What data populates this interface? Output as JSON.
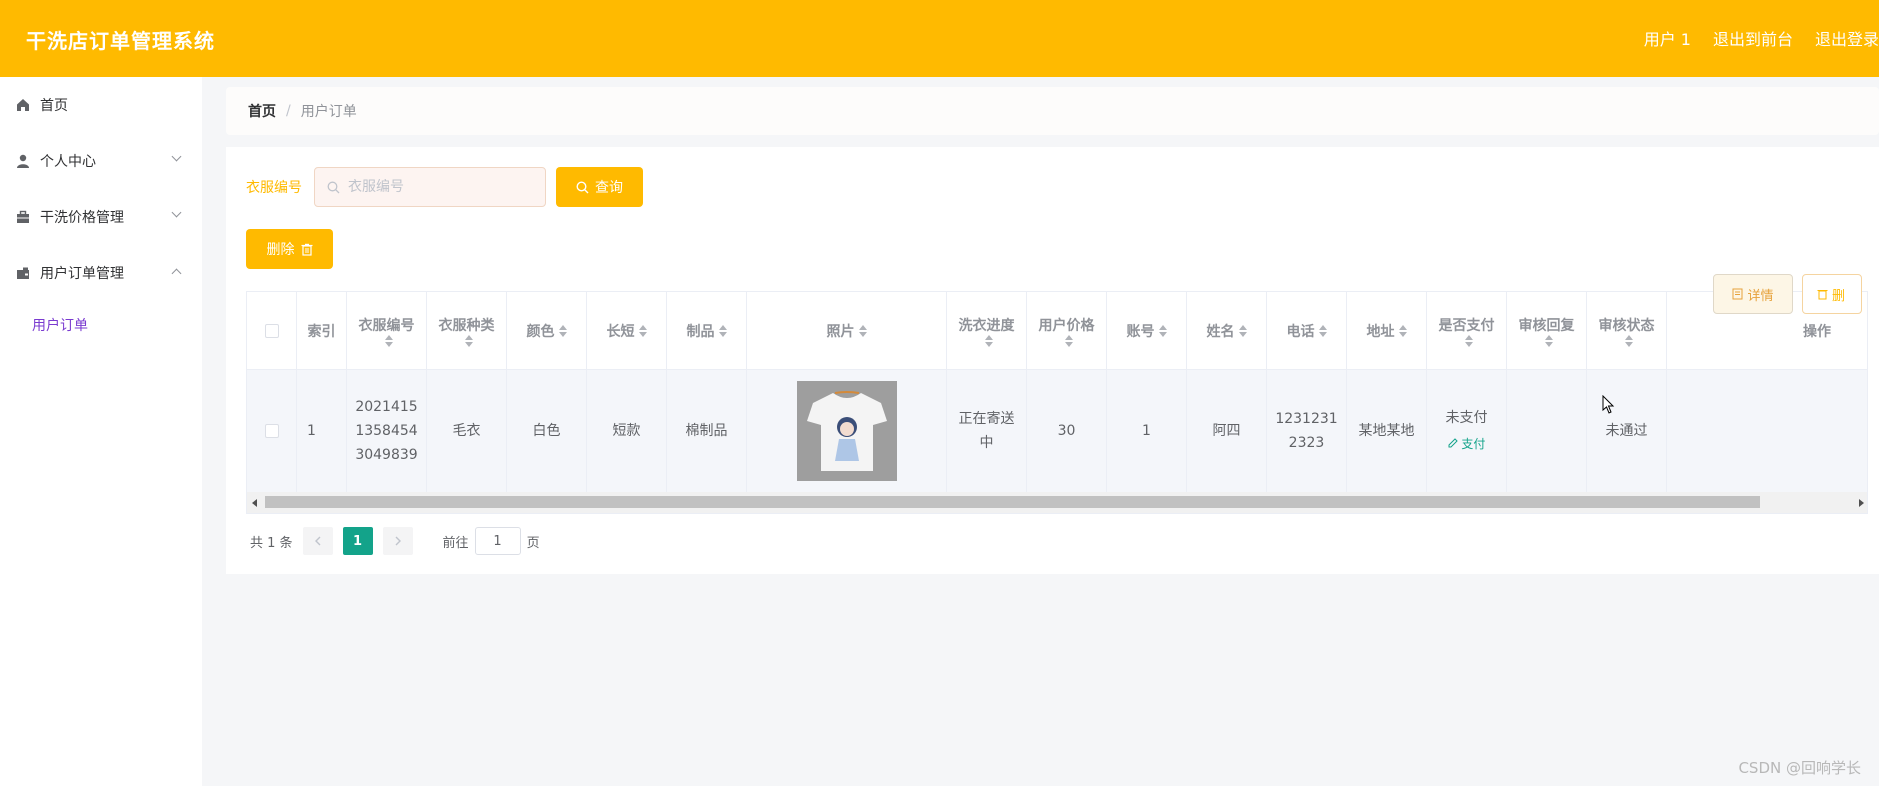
{
  "header": {
    "title": "干洗店订单管理系统",
    "user": "用户 1",
    "back_to_front": "退出到前台",
    "logout": "退出登录"
  },
  "sidebar": {
    "items": [
      {
        "label": "首页",
        "icon": "home-icon"
      },
      {
        "label": "个人中心",
        "icon": "user-icon"
      },
      {
        "label": "干洗价格管理",
        "icon": "briefcase-icon"
      },
      {
        "label": "用户订单管理",
        "icon": "wallet-icon"
      }
    ],
    "subitem": "用户订单"
  },
  "breadcrumb": {
    "home": "首页",
    "sep": "/",
    "current": "用户订单"
  },
  "search": {
    "label": "衣服编号",
    "placeholder": "衣服编号",
    "button": "查询"
  },
  "delete_button": "删除",
  "table": {
    "headers": [
      "索引",
      "衣服编号",
      "衣服种类",
      "颜色",
      "长短",
      "制品",
      "照片",
      "洗衣进度",
      "用户价格",
      "账号",
      "姓名",
      "电话",
      "地址",
      "是否支付",
      "审核回复",
      "审核状态",
      "操作"
    ],
    "row": {
      "index": "1",
      "clothes_no_lines": [
        "2021415",
        "1358454",
        "3049839"
      ],
      "type": "毛衣",
      "color": "白色",
      "length": "短款",
      "material": "棉制品",
      "progress_lines": [
        "正在寄送",
        "中"
      ],
      "price": "30",
      "account": "1",
      "name": "阿四",
      "phone_lines": [
        "1231231",
        "2323"
      ],
      "address": "某地某地",
      "pay_status": "未支付",
      "pay_link": "支付",
      "review_reply": "",
      "review_status": "未通过",
      "detail_btn": "详情",
      "delete_btn": "删"
    }
  },
  "pagination": {
    "total": "共 1 条",
    "current_page": "1",
    "goto_prefix": "前往",
    "goto_value": "1",
    "goto_suffix": "页"
  },
  "watermark": "CSDN @回响学长",
  "colors": {
    "primary": "#ffba00",
    "accent_green": "#13a38a",
    "submenu": "#7a3bd0"
  }
}
